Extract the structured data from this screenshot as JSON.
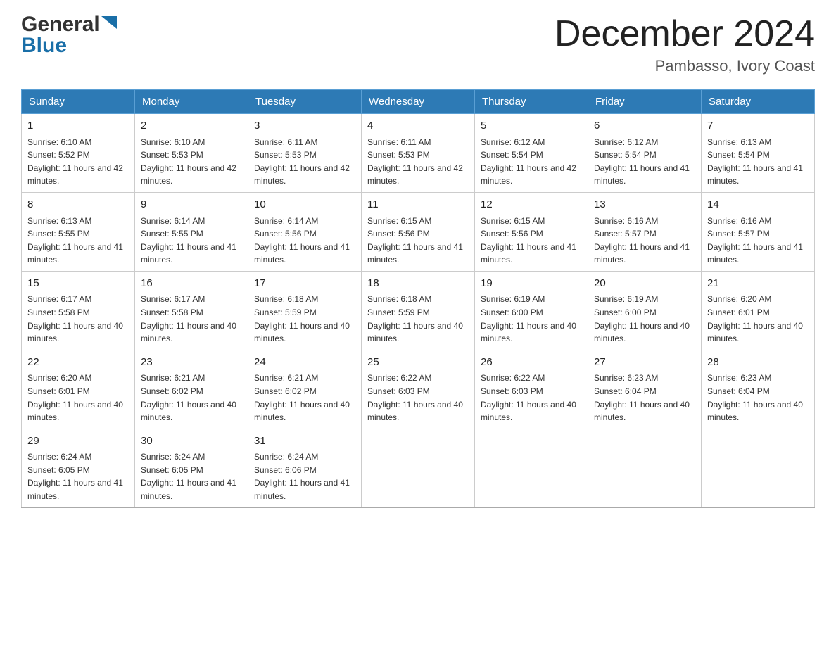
{
  "header": {
    "logo_general": "General",
    "logo_blue": "Blue",
    "month_title": "December 2024",
    "location": "Pambasso, Ivory Coast"
  },
  "calendar": {
    "days_of_week": [
      "Sunday",
      "Monday",
      "Tuesday",
      "Wednesday",
      "Thursday",
      "Friday",
      "Saturday"
    ],
    "weeks": [
      [
        {
          "day": "1",
          "sunrise": "6:10 AM",
          "sunset": "5:52 PM",
          "daylight": "11 hours and 42 minutes."
        },
        {
          "day": "2",
          "sunrise": "6:10 AM",
          "sunset": "5:53 PM",
          "daylight": "11 hours and 42 minutes."
        },
        {
          "day": "3",
          "sunrise": "6:11 AM",
          "sunset": "5:53 PM",
          "daylight": "11 hours and 42 minutes."
        },
        {
          "day": "4",
          "sunrise": "6:11 AM",
          "sunset": "5:53 PM",
          "daylight": "11 hours and 42 minutes."
        },
        {
          "day": "5",
          "sunrise": "6:12 AM",
          "sunset": "5:54 PM",
          "daylight": "11 hours and 42 minutes."
        },
        {
          "day": "6",
          "sunrise": "6:12 AM",
          "sunset": "5:54 PM",
          "daylight": "11 hours and 41 minutes."
        },
        {
          "day": "7",
          "sunrise": "6:13 AM",
          "sunset": "5:54 PM",
          "daylight": "11 hours and 41 minutes."
        }
      ],
      [
        {
          "day": "8",
          "sunrise": "6:13 AM",
          "sunset": "5:55 PM",
          "daylight": "11 hours and 41 minutes."
        },
        {
          "day": "9",
          "sunrise": "6:14 AM",
          "sunset": "5:55 PM",
          "daylight": "11 hours and 41 minutes."
        },
        {
          "day": "10",
          "sunrise": "6:14 AM",
          "sunset": "5:56 PM",
          "daylight": "11 hours and 41 minutes."
        },
        {
          "day": "11",
          "sunrise": "6:15 AM",
          "sunset": "5:56 PM",
          "daylight": "11 hours and 41 minutes."
        },
        {
          "day": "12",
          "sunrise": "6:15 AM",
          "sunset": "5:56 PM",
          "daylight": "11 hours and 41 minutes."
        },
        {
          "day": "13",
          "sunrise": "6:16 AM",
          "sunset": "5:57 PM",
          "daylight": "11 hours and 41 minutes."
        },
        {
          "day": "14",
          "sunrise": "6:16 AM",
          "sunset": "5:57 PM",
          "daylight": "11 hours and 41 minutes."
        }
      ],
      [
        {
          "day": "15",
          "sunrise": "6:17 AM",
          "sunset": "5:58 PM",
          "daylight": "11 hours and 40 minutes."
        },
        {
          "day": "16",
          "sunrise": "6:17 AM",
          "sunset": "5:58 PM",
          "daylight": "11 hours and 40 minutes."
        },
        {
          "day": "17",
          "sunrise": "6:18 AM",
          "sunset": "5:59 PM",
          "daylight": "11 hours and 40 minutes."
        },
        {
          "day": "18",
          "sunrise": "6:18 AM",
          "sunset": "5:59 PM",
          "daylight": "11 hours and 40 minutes."
        },
        {
          "day": "19",
          "sunrise": "6:19 AM",
          "sunset": "6:00 PM",
          "daylight": "11 hours and 40 minutes."
        },
        {
          "day": "20",
          "sunrise": "6:19 AM",
          "sunset": "6:00 PM",
          "daylight": "11 hours and 40 minutes."
        },
        {
          "day": "21",
          "sunrise": "6:20 AM",
          "sunset": "6:01 PM",
          "daylight": "11 hours and 40 minutes."
        }
      ],
      [
        {
          "day": "22",
          "sunrise": "6:20 AM",
          "sunset": "6:01 PM",
          "daylight": "11 hours and 40 minutes."
        },
        {
          "day": "23",
          "sunrise": "6:21 AM",
          "sunset": "6:02 PM",
          "daylight": "11 hours and 40 minutes."
        },
        {
          "day": "24",
          "sunrise": "6:21 AM",
          "sunset": "6:02 PM",
          "daylight": "11 hours and 40 minutes."
        },
        {
          "day": "25",
          "sunrise": "6:22 AM",
          "sunset": "6:03 PM",
          "daylight": "11 hours and 40 minutes."
        },
        {
          "day": "26",
          "sunrise": "6:22 AM",
          "sunset": "6:03 PM",
          "daylight": "11 hours and 40 minutes."
        },
        {
          "day": "27",
          "sunrise": "6:23 AM",
          "sunset": "6:04 PM",
          "daylight": "11 hours and 40 minutes."
        },
        {
          "day": "28",
          "sunrise": "6:23 AM",
          "sunset": "6:04 PM",
          "daylight": "11 hours and 40 minutes."
        }
      ],
      [
        {
          "day": "29",
          "sunrise": "6:24 AM",
          "sunset": "6:05 PM",
          "daylight": "11 hours and 41 minutes."
        },
        {
          "day": "30",
          "sunrise": "6:24 AM",
          "sunset": "6:05 PM",
          "daylight": "11 hours and 41 minutes."
        },
        {
          "day": "31",
          "sunrise": "6:24 AM",
          "sunset": "6:06 PM",
          "daylight": "11 hours and 41 minutes."
        },
        null,
        null,
        null,
        null
      ]
    ]
  }
}
